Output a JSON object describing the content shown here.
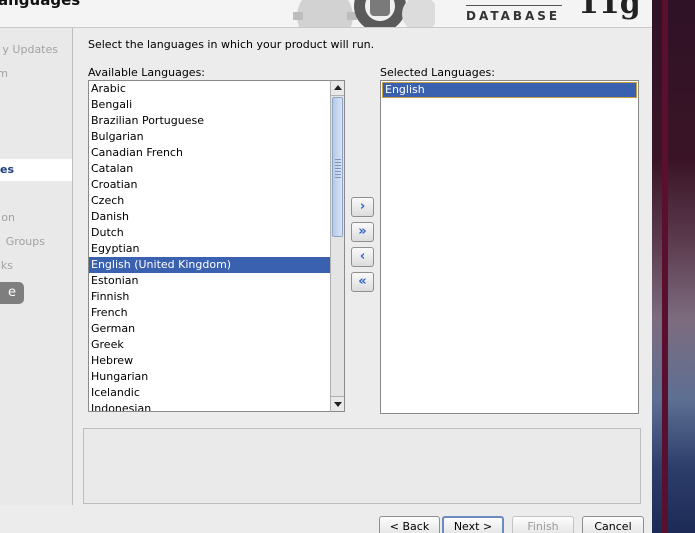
{
  "banner": {
    "title": "anguages",
    "db_text": "DATABASE",
    "brand": "11g"
  },
  "sidebar": {
    "items": [
      {
        "label": "y Updates",
        "active": false
      },
      {
        "label": "m",
        "active": false
      },
      {
        "label": "es",
        "active": true
      },
      {
        "label": "on",
        "active": false
      },
      {
        "label": "Groups",
        "active": false
      },
      {
        "label": "ks",
        "active": false
      }
    ],
    "button_label": "e"
  },
  "instruction": "Select the languages in which your product will run.",
  "available": {
    "label": "Available Languages:",
    "items": [
      "Arabic",
      "Bengali",
      "Brazilian Portuguese",
      "Bulgarian",
      "Canadian French",
      "Catalan",
      "Croatian",
      "Czech",
      "Danish",
      "Dutch",
      "Egyptian",
      "English (United Kingdom)",
      "Estonian",
      "Finnish",
      "French",
      "German",
      "Greek",
      "Hebrew",
      "Hungarian",
      "Icelandic",
      "Indonesian"
    ],
    "selected": "English (United Kingdom)"
  },
  "selected_list": {
    "label": "Selected Languages:",
    "items": [
      "English"
    ]
  },
  "move_buttons": [
    {
      "name": "move-right-button",
      "glyph": "›"
    },
    {
      "name": "move-all-right-button",
      "glyph": "»"
    },
    {
      "name": "move-left-button",
      "glyph": "‹"
    },
    {
      "name": "move-all-left-button",
      "glyph": "«"
    }
  ],
  "buttons": {
    "back": "< Back",
    "next": "Next >",
    "finish": "Finish",
    "cancel": "Cancel"
  },
  "colors": {
    "selection": "#3a60b0",
    "sidebar_active_text": "#1b3e7c"
  }
}
